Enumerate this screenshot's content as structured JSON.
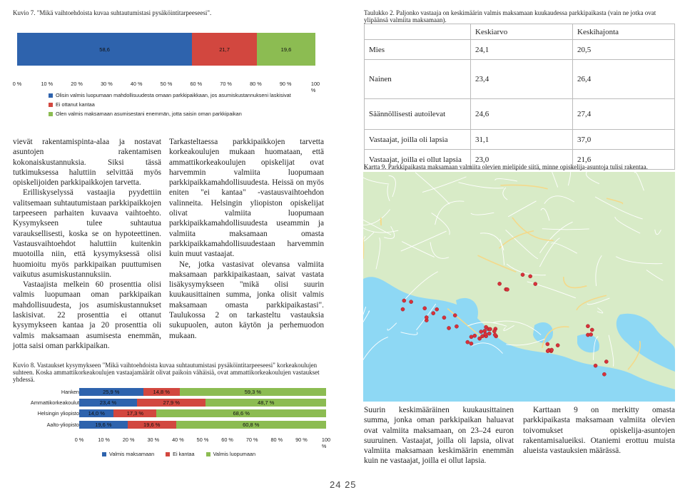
{
  "left": {
    "fig7": {
      "caption": "Kuvio 7. \"Mikä vaihtoehdoista kuvaa suhtautumistasi pysäköintitarpeeseesi\".",
      "values": [
        58.6,
        21.7,
        19.6
      ],
      "labels": [
        "58,6",
        "21,7",
        "19,6"
      ],
      "colors": [
        "#2e63ad",
        "#d2473f",
        "#8cbc52"
      ],
      "ticks": [
        "0 %",
        "10 %",
        "20 %",
        "30 %",
        "40 %",
        "50 %",
        "60 %",
        "70 %",
        "80 %",
        "90 %",
        "100 %"
      ],
      "legend": [
        "Olisin valmis luopumaan mahdollisuudesta omaan parkkipaikkaan, jos asumiskustannukseni laskisivat",
        "Ei ottanut kantaa",
        "Olen valmis maksamaan asumisestani enemmän, jotta saisin oman parkkipaikan"
      ]
    },
    "col1": [
      "vievät rakentamispinta-alaa ja nostavat asuntojen rakentamisen kokonaiskustannuksia. Siksi tässä tutkimuksessa haluttiin selvittää myös opiskelijoiden parkkipaikkojen tarvetta.",
      "Erilliskyselyssä vastaajia pyydettiin valitsemaan suhtautumistaan parkkipaikkojen tarpeeseen parhaiten kuvaava vaihtoehto. Kysymykseen tulee suhtautua varauksellisesti, koska se on hypoteettinen. Vastausvaihtoehdot haluttiin kuitenkin muotoilla niin, että kysymyksessä olisi huomioitu myös parkkipaikan puuttumisen vaikutus asumiskustannuksiin.",
      "Vastaajista melkein 60 prosenttia olisi valmis luopumaan oman parkkipaikan mahdollisuudesta, jos asumiskustannukset laskisivat. 22 prosenttia ei ottanut kysymykseen kantaa ja 20 prosenttia oli valmis maksamaan asumisesta enemmän, jotta saisi oman parkkipaikan."
    ],
    "col2": [
      "Tarkasteltaessa parkkipaikkojen tarvetta korkeakoulujen mukaan huomataan, että ammattikorkeakoulujen opiskelijat ovat harvemmin valmiita luopumaan parkkipaikkamahdollisuudesta. Heissä on myös eniten \"ei kantaa\" -vastausvaihtoehdon valinneita. Helsingin yliopiston opiskelijat olivat valmiita luopumaan parkkipaikkamahdollisuudesta useammin ja valmiita maksamaan omasta parkkipaikkamahdollisuudestaan harvemmin kuin muut vastaajat.",
      "Ne, jotka vastasivat olevansa valmiita maksamaan parkkipaikastaan, saivat vastata lisäkysymykseen \"mikä olisi suurin kuukausittainen summa, jonka olisit valmis maksamaan omasta parkkipaikastasi\". Taulukossa 2 on tarkasteltu vastauksia sukupuolen, auton käytön ja perhemuodon mukaan."
    ],
    "fig8": {
      "caption": "Kuvio 8. Vastaukset kysymykseen \"Mikä vaihtoehdoista kuvaa suhtautumistasi pysäköintitarpeeseesi\" korkeakoulujen suhteen. Koska ammattikorkeakoulujen vastaajamäärät olivat paikoin vähäisiä, ovat ammattikorkeakoulujen vastaukset yhdessä.",
      "rows": [
        {
          "name": "Hanken",
          "values": [
            25.9,
            14.8,
            59.3
          ],
          "labels": [
            "25,9 %",
            "14,8 %",
            "59,3 %"
          ]
        },
        {
          "name": "Ammattikorkeakoulut",
          "values": [
            23.4,
            27.9,
            48.7
          ],
          "labels": [
            "23,4 %",
            "27,9 %",
            "48,7 %"
          ]
        },
        {
          "name": "Helsingin yliopisto",
          "values": [
            14.0,
            17.3,
            68.6
          ],
          "labels": [
            "14,0 %",
            "17,3 %",
            "68,6 %"
          ]
        },
        {
          "name": "Aalto-yliopisto",
          "values": [
            19.6,
            19.6,
            60.8
          ],
          "labels": [
            "19,6 %",
            "19,6 %",
            "60,8 %"
          ]
        }
      ],
      "colors": [
        "#2e63ad",
        "#d2473f",
        "#8cbc52"
      ],
      "ticks": [
        "0 %",
        "10 %",
        "20 %",
        "30 %",
        "40 %",
        "50 %",
        "60 %",
        "70 %",
        "80 %",
        "90 %",
        "100 %"
      ],
      "legend": [
        "Valmis maksamaan",
        "Ei kantaa",
        "Valmis luopumaan"
      ]
    }
  },
  "right": {
    "table2": {
      "caption": "Taulukko 2. Paljonko vastaaja on keskimäärin valmis maksamaan kuukaudessa parkkipaikasta (vain ne jotka ovat ylipäänsä valmiita maksamaan).",
      "headers": [
        "",
        "Keskiarvo",
        "Keskihajonta"
      ],
      "rows": [
        [
          "Mies",
          "24,1",
          "20,5"
        ],
        [
          "Nainen",
          "23,4",
          "26,4"
        ],
        [
          "Säännöllisesti autoilevat",
          "24,6",
          "27,4"
        ],
        [
          "Vastaajat, joilla oli lapsia",
          "31,1",
          "37,0"
        ],
        [
          "Vastaajat, joilla ei ollut lapsia",
          "23,0",
          "21,6"
        ]
      ]
    },
    "map": {
      "caption": "Kartta 9. Parkkipaikasta maksamaan valmiita olevien mielipide siitä, minne opiskelija-asuntoja tulisi rakentaa.",
      "water_color": "#8ed8f4",
      "land_color": "#d8ebc7",
      "marker_color": "#d8313a"
    },
    "col1": [
      "Suurin keskimääräinen kuukausittainen summa, jonka oman parkkipaikan haluavat ovat valmiita maksamaan, on 23–24 euron suuruinen. Vastaajat, joilla oli lapsia, olivat valmiita maksamaan keskimäärin enemmän kuin ne vastaajat, joilla ei ollut lapsia."
    ],
    "col2": [
      "Karttaan 9 on merkitty omasta parkkipaikasta maksamaan valmiita olevien toivomukset opiskelija-asuntojen rakentamisalueiksi. Otaniemi erottuu muista alueista vastauksien määrässä."
    ]
  },
  "page_numbers": "24 25"
}
